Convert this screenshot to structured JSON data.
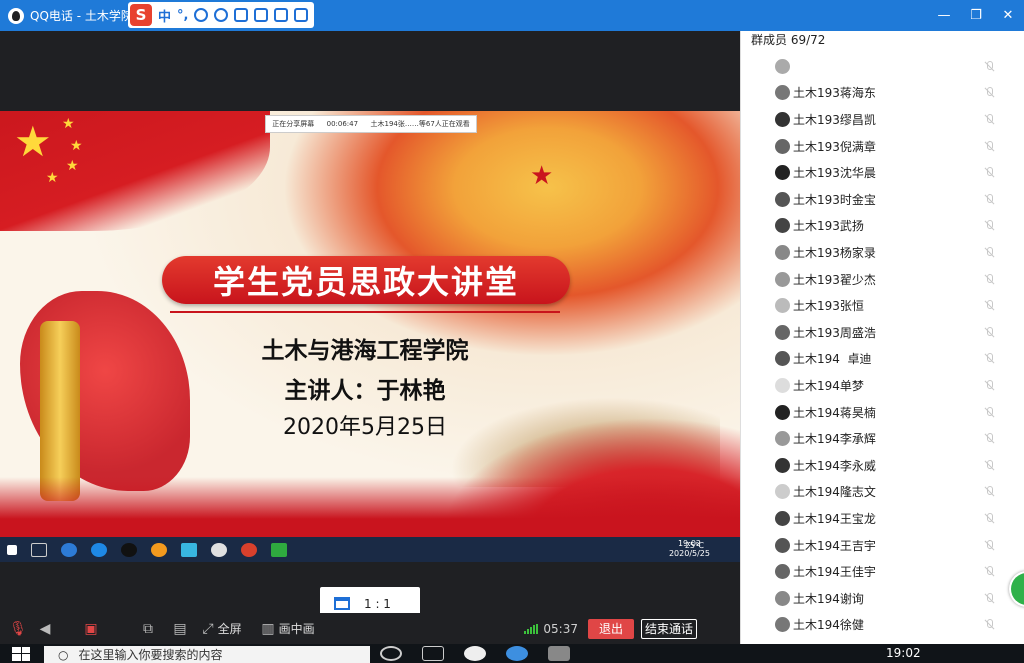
{
  "window": {
    "app_title": "QQ电话 - 土木学院",
    "controls": [
      "—",
      "❐",
      "✕"
    ]
  },
  "ime": {
    "logo": "S",
    "mode": "中",
    "punct": "°,"
  },
  "share_bar": {
    "status": "正在分享屏幕",
    "duration": "00:06:47",
    "viewers": "土木194张……等67人正在观看"
  },
  "slide": {
    "banner": "学生党员思政大讲堂",
    "school": "土木与港海工程学院",
    "speaker": "主讲人：于林艳",
    "date": "2020年5月25日"
  },
  "inner_taskbar": {
    "weather": "25℃",
    "time": "19:02",
    "date": "2020/5/25"
  },
  "ratio_button": {
    "label": "1 : 1"
  },
  "controls": {
    "fullscreen": "全屏",
    "pip": "画中画",
    "call_timer": "05:37",
    "exit": "退出",
    "end_call": "结束通话"
  },
  "panel": {
    "title": "群成员 69/72",
    "members": [
      {
        "name": ""
      },
      {
        "name": "土木193蒋海东"
      },
      {
        "name": "土木193缪昌凯"
      },
      {
        "name": "土木193倪满章"
      },
      {
        "name": "土木193沈华晨"
      },
      {
        "name": "土木193时金宝"
      },
      {
        "name": "土木193武扬"
      },
      {
        "name": "土木193杨家录"
      },
      {
        "name": "土木193翟少杰"
      },
      {
        "name": "土木193张恒"
      },
      {
        "name": "土木193周盛浩"
      },
      {
        "name": "土木194  卓迪"
      },
      {
        "name": "土木194单梦"
      },
      {
        "name": "土木194蒋昊楠"
      },
      {
        "name": "土木194李承辉"
      },
      {
        "name": "土木194李永威"
      },
      {
        "name": "土木194隆志文"
      },
      {
        "name": "土木194王宝龙"
      },
      {
        "name": "土木194王吉宇"
      },
      {
        "name": "土木194王佳宇"
      },
      {
        "name": "土木194谢询"
      },
      {
        "name": "土木194徐健"
      }
    ]
  },
  "taskbar": {
    "search_placeholder": "在这里输入你要搜索的内容",
    "time": "19:02"
  }
}
